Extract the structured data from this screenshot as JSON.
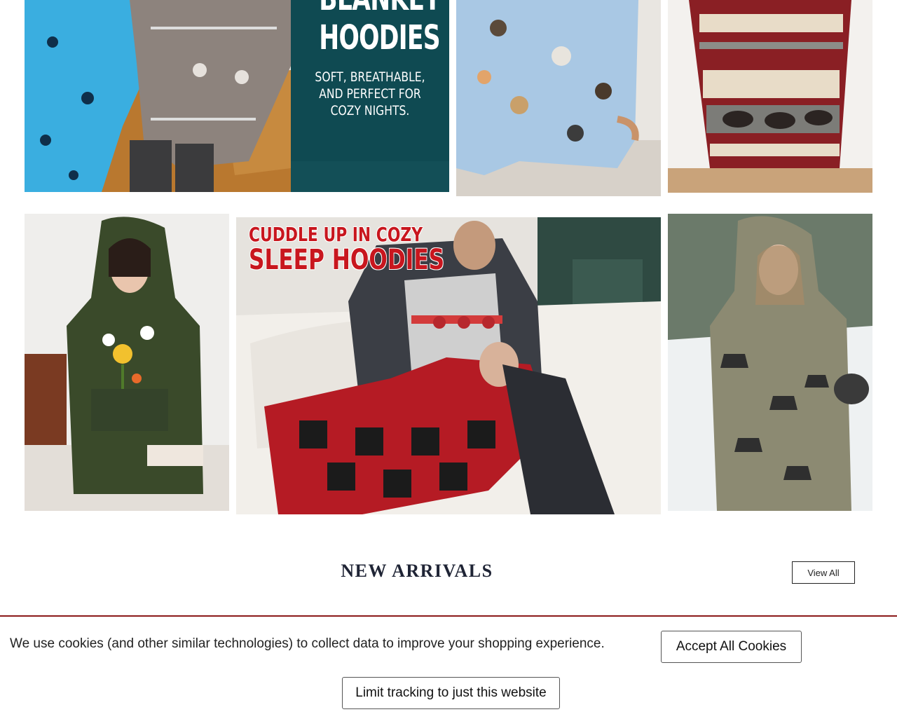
{
  "banners": {
    "blanket_hoodies": {
      "title_line1": "BLANKET",
      "title_line2": "HOODIES",
      "subtitle": "SOFT, BREATHABLE, AND PERFECT FOR COZY NIGHTS."
    },
    "sleep_hoodies": {
      "line1": "CUDDLE UP IN COZY",
      "line2": "SLEEP HOODIES"
    }
  },
  "new_arrivals": {
    "title": "NEW ARRIVALS",
    "view_all_label": "View All"
  },
  "cookie_banner": {
    "message": "We use cookies (and other similar technologies) to collect data to improve your shopping experience.",
    "accept_label": "Accept All Cookies",
    "limit_label": "Limit tracking to just this website"
  },
  "colors": {
    "promo_teal": "#0f4a52",
    "brand_red": "#c8161e",
    "cookie_border": "#8b1a1a",
    "heading_navy": "#1f2435"
  }
}
